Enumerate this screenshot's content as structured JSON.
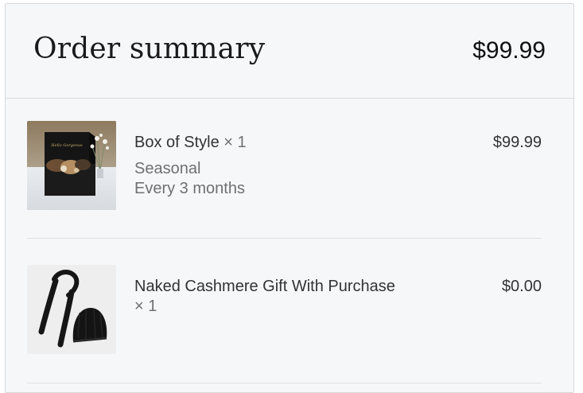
{
  "summary": {
    "title": "Order summary",
    "total": "$99.99"
  },
  "items": [
    {
      "name": "Box of Style",
      "quantity": "× 1",
      "price": "$99.99",
      "details": [
        "Seasonal",
        "Every 3 months"
      ],
      "image_label": "Hello Gorgeous",
      "image_icon": "gift-box-product-image"
    },
    {
      "name": "Naked Cashmere Gift With Purchase",
      "quantity": "× 1",
      "price": "$0.00",
      "details": [],
      "image_icon": "scarf-and-beanie-product-image"
    }
  ],
  "colors": {
    "panel_background": "#f6f7f9",
    "border": "#d6d8dc",
    "text_primary": "#333333",
    "text_secondary": "#707070"
  }
}
